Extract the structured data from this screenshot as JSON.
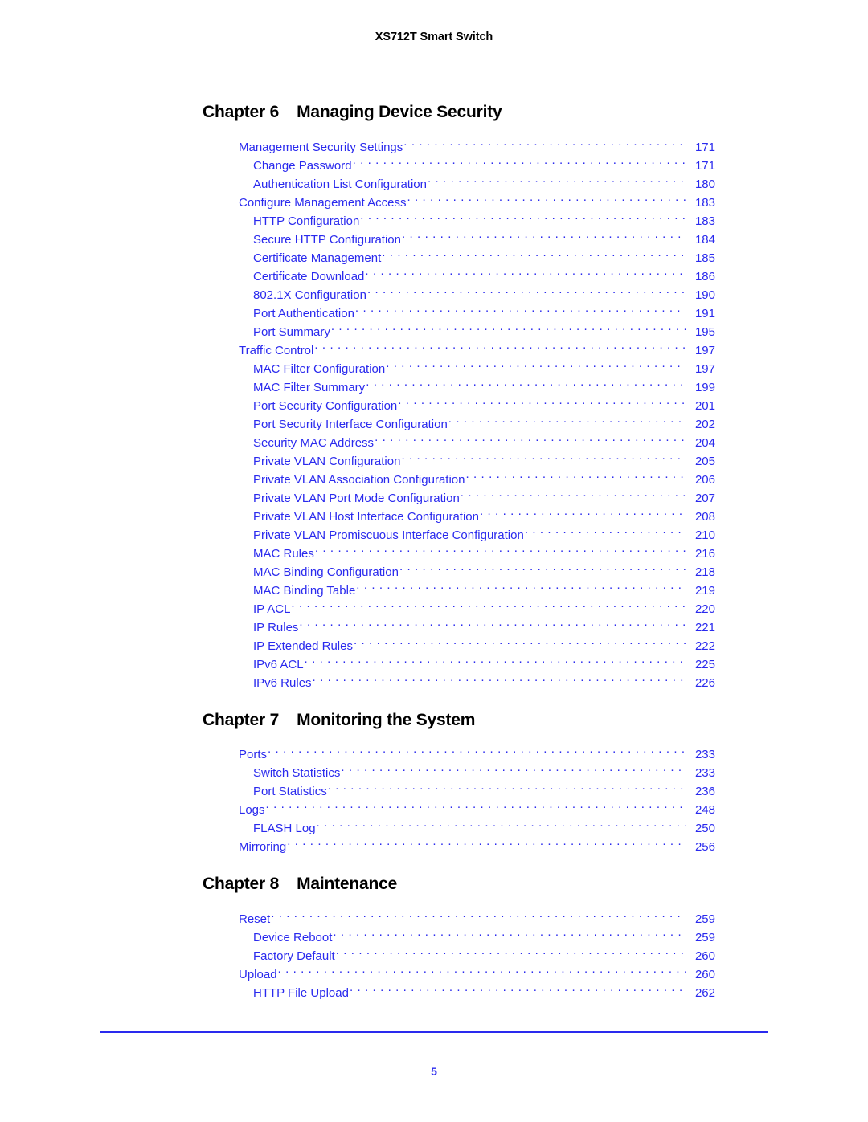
{
  "header": {
    "running_title": "XS712T Smart Switch"
  },
  "footer": {
    "page_number": "5",
    "rule_color": "#2A2AEE"
  },
  "colors": {
    "toc_link": "#2A2AEE",
    "heading": "#000000",
    "page_background": "#ffffff"
  },
  "chapters": [
    {
      "label": "Chapter 6",
      "title": "Managing Device Security",
      "entries": [
        {
          "level": 1,
          "title": "Management Security Settings",
          "page": "171"
        },
        {
          "level": 2,
          "title": "Change Password",
          "page": "171"
        },
        {
          "level": 2,
          "title": "Authentication List Configuration",
          "page": "180"
        },
        {
          "level": 1,
          "title": "Configure Management Access",
          "page": "183"
        },
        {
          "level": 2,
          "title": "HTTP Configuration",
          "page": "183"
        },
        {
          "level": 2,
          "title": "Secure HTTP Configuration",
          "page": "184"
        },
        {
          "level": 2,
          "title": "Certificate Management",
          "page": "185"
        },
        {
          "level": 2,
          "title": "Certificate Download",
          "page": "186"
        },
        {
          "level": 2,
          "title": "802.1X Configuration",
          "page": "190"
        },
        {
          "level": 2,
          "title": "Port Authentication",
          "page": "191"
        },
        {
          "level": 2,
          "title": "Port Summary",
          "page": "195"
        },
        {
          "level": 1,
          "title": "Traffic Control",
          "page": "197"
        },
        {
          "level": 2,
          "title": "MAC Filter Configuration",
          "page": "197"
        },
        {
          "level": 2,
          "title": "MAC Filter Summary",
          "page": "199"
        },
        {
          "level": 2,
          "title": "Port Security Configuration",
          "page": "201"
        },
        {
          "level": 2,
          "title": "Port Security Interface Configuration",
          "page": "202"
        },
        {
          "level": 2,
          "title": "Security MAC Address",
          "page": "204"
        },
        {
          "level": 2,
          "title": "Private VLAN Configuration",
          "page": "205"
        },
        {
          "level": 2,
          "title": "Private VLAN Association Configuration",
          "page": "206"
        },
        {
          "level": 2,
          "title": "Private VLAN Port Mode Configuration",
          "page": "207"
        },
        {
          "level": 2,
          "title": "Private VLAN Host Interface Configuration",
          "page": "208"
        },
        {
          "level": 2,
          "title": "Private VLAN Promiscuous Interface Configuration",
          "page": "210"
        },
        {
          "level": 2,
          "title": "MAC Rules",
          "page": "216"
        },
        {
          "level": 2,
          "title": "MAC Binding Configuration",
          "page": "218"
        },
        {
          "level": 2,
          "title": "MAC Binding Table",
          "page": "219"
        },
        {
          "level": 2,
          "title": "IP ACL",
          "page": "220"
        },
        {
          "level": 2,
          "title": "IP Rules",
          "page": "221"
        },
        {
          "level": 2,
          "title": "IP Extended Rules",
          "page": "222"
        },
        {
          "level": 2,
          "title": "IPv6 ACL",
          "page": "225"
        },
        {
          "level": 2,
          "title": "IPv6 Rules",
          "page": "226"
        }
      ]
    },
    {
      "label": "Chapter 7",
      "title": "Monitoring the System",
      "entries": [
        {
          "level": 1,
          "title": "Ports",
          "page": "233"
        },
        {
          "level": 2,
          "title": "Switch Statistics",
          "page": "233"
        },
        {
          "level": 2,
          "title": "Port Statistics",
          "page": "236"
        },
        {
          "level": 1,
          "title": "Logs",
          "page": "248"
        },
        {
          "level": 2,
          "title": "FLASH Log",
          "page": "250"
        },
        {
          "level": 1,
          "title": "Mirroring",
          "page": "256"
        }
      ]
    },
    {
      "label": "Chapter 8",
      "title": "Maintenance",
      "entries": [
        {
          "level": 1,
          "title": "Reset",
          "page": "259"
        },
        {
          "level": 2,
          "title": "Device Reboot",
          "page": "259"
        },
        {
          "level": 2,
          "title": "Factory Default",
          "page": "260"
        },
        {
          "level": 1,
          "title": "Upload",
          "page": "260"
        },
        {
          "level": 2,
          "title": "HTTP File Upload",
          "page": "262"
        }
      ]
    }
  ]
}
